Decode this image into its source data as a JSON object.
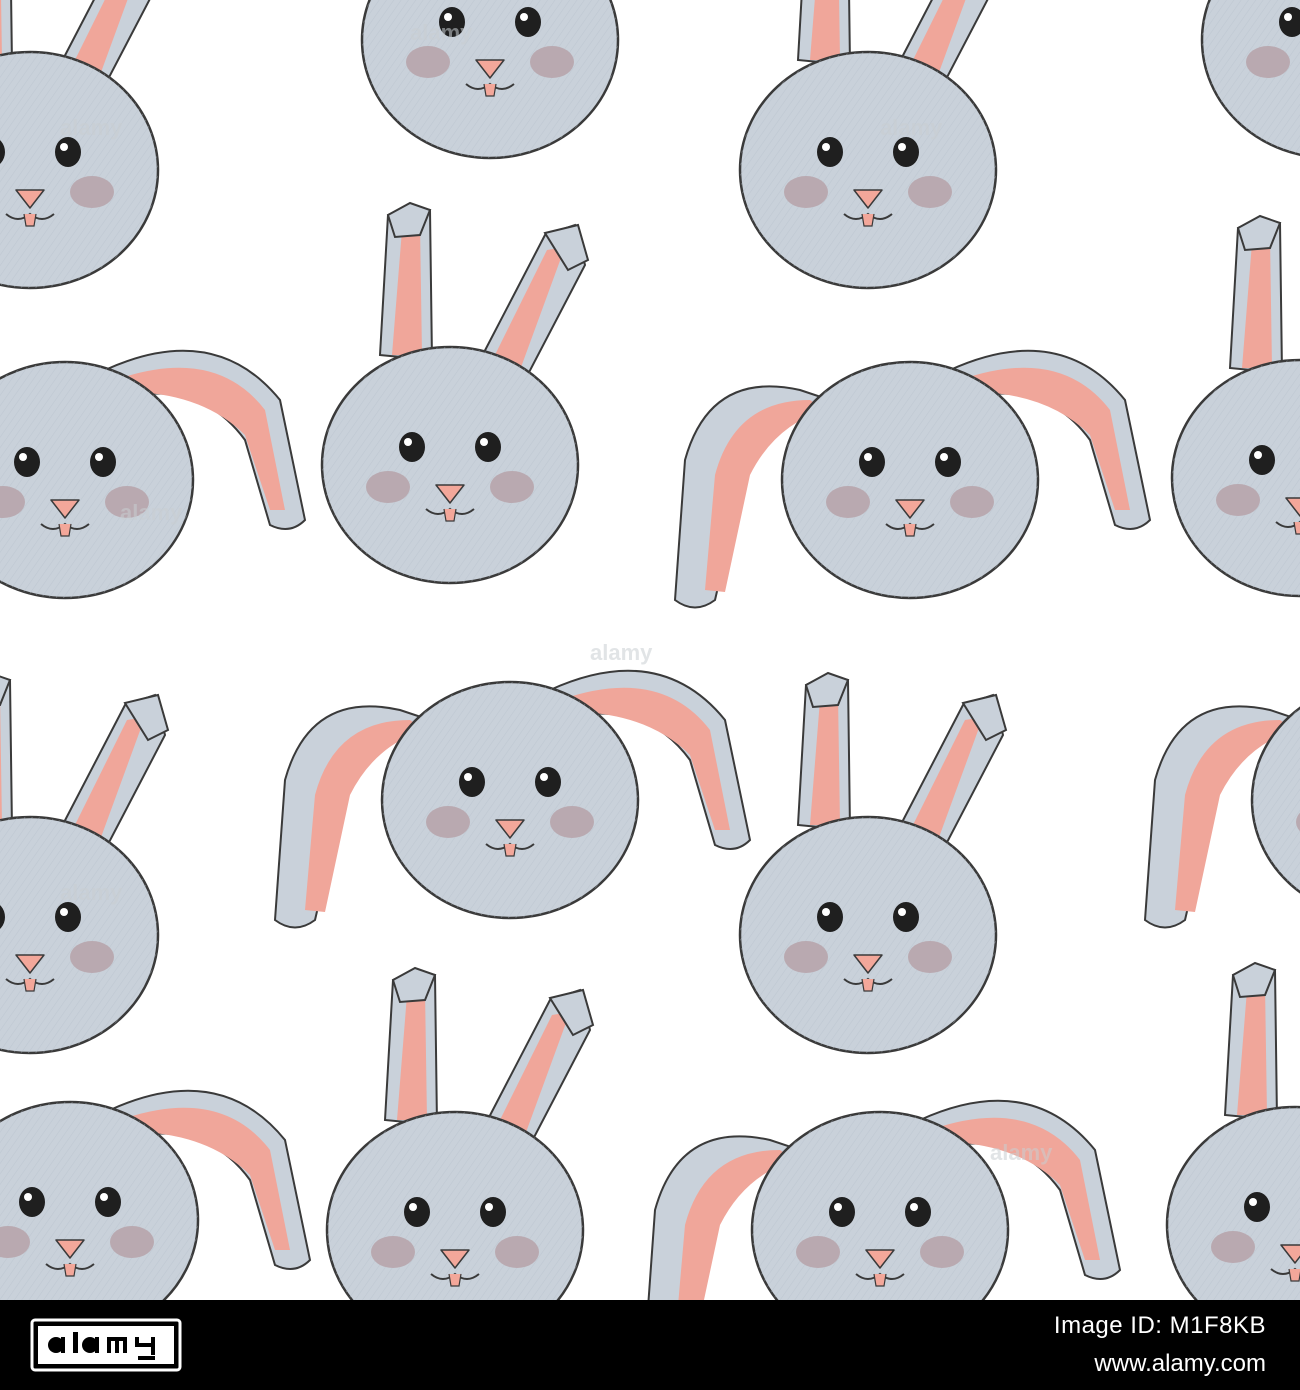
{
  "image": {
    "subject": "seamless pattern of cartoon bunny faces",
    "colors": {
      "background": "#ffffff",
      "fur": "#c9d1da",
      "inner_ear": "#f0a69a",
      "cheek": "#b9a9b0",
      "nose": "#f3a79a",
      "outline": "#3a3a3a",
      "eye": "#1f1f1f"
    },
    "watermark": "alamy"
  },
  "footer": {
    "logo": "alamy",
    "image_id": "Image ID: M1F8KB",
    "url": "www.alamy.com",
    "background": "#000000"
  }
}
